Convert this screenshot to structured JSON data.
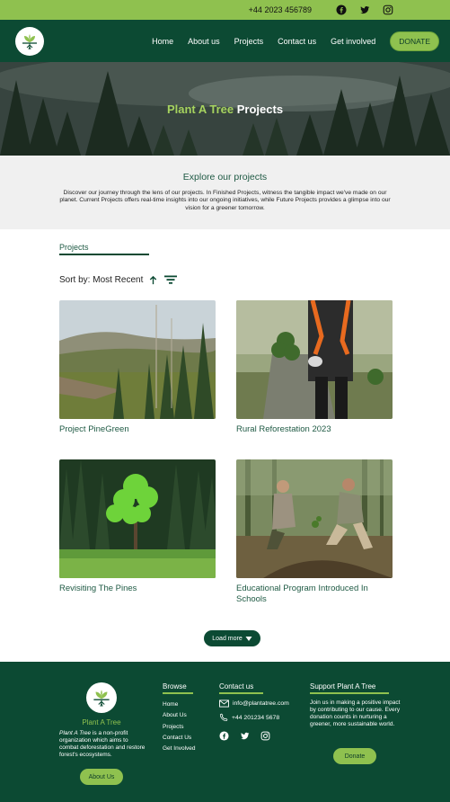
{
  "topbar": {
    "phone": "+44 2023 456789",
    "social": [
      {
        "icon": "facebook-icon"
      },
      {
        "icon": "twitter-icon"
      },
      {
        "icon": "instagram-icon"
      }
    ]
  },
  "nav": {
    "logo_icon": "tree-logo-icon",
    "items": [
      "Home",
      "About us",
      "Projects",
      "Contact us",
      "Get involved"
    ],
    "donate_label": "DONATE"
  },
  "hero": {
    "brand": "Plant A Tree",
    "title_rest": "Projects"
  },
  "explore": {
    "heading": "Explore our projects",
    "body": "Discover our journey through the lens of our projects. In Finished Projects, witness the tangible impact we've made on our planet. Current Projects offers real-time insights into our ongoing initiatives, while Future Projects provides a glimpse into our vision for a greener tomorrow."
  },
  "projects": {
    "section_title": "Projects",
    "sort_label": "Sort by: Most Recent",
    "cards": [
      {
        "title": "Project PineGreen"
      },
      {
        "title": "Rural Reforestation 2023"
      },
      {
        "title": "Revisiting The Pines"
      },
      {
        "title": "Educational Program Introduced In Schools"
      }
    ],
    "load_more_label": "Load more"
  },
  "footer": {
    "brand": "Plant A Tree",
    "about_em": "Plant A Tree",
    "about_rest": " is a non-profit organization which aims to combat deforestation and restore forest's ecosystems.",
    "about_button": "About Us",
    "browse": {
      "heading": "Browse",
      "links": [
        "Home",
        "About Us",
        "Projects",
        "Contact Us",
        "Get Involved"
      ]
    },
    "contact": {
      "heading": "Contact us",
      "email": "info@plantatree.com",
      "phone": "+44 201234 5678"
    },
    "support": {
      "heading": "Support Plant A Tree",
      "text": "Join us in making a positive impact by contributing to our cause. Every donation counts in nurturing a greener, more sustainable world.",
      "button": "Donate"
    }
  },
  "colors": {
    "primary_dark_green": "#0c4a33",
    "accent_green": "#8fc14f",
    "link_green": "#1f5a44"
  }
}
